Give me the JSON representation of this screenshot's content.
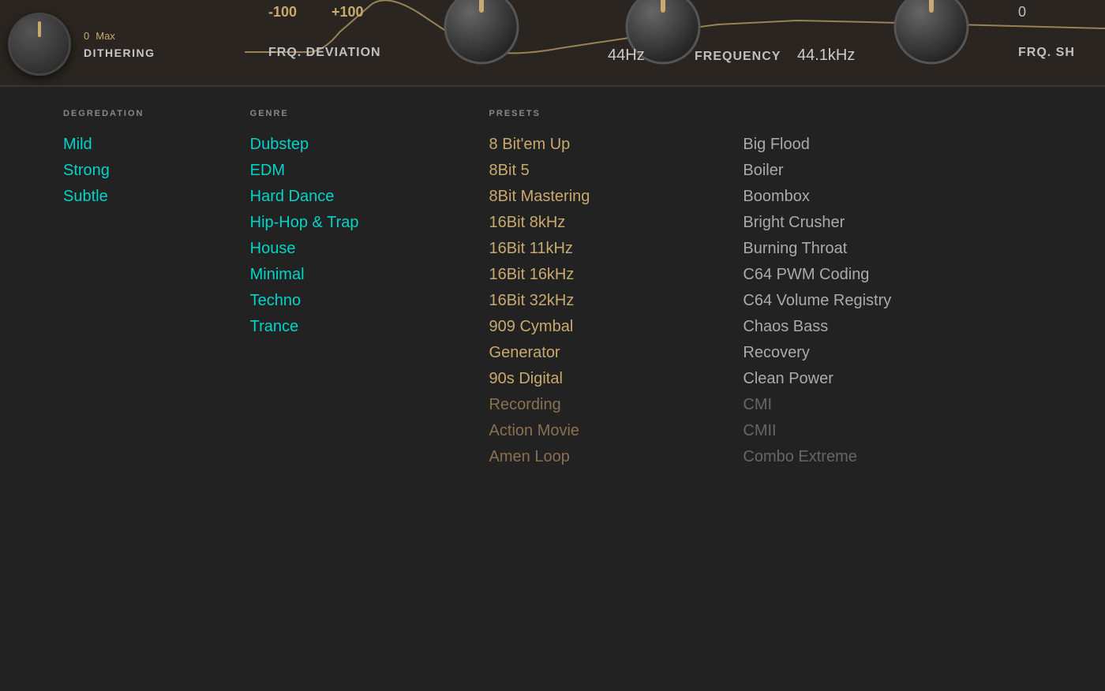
{
  "header": {
    "dithering": {
      "label": "DITHERING",
      "range_min": "0",
      "range_max": "Max"
    },
    "frq_deviation": {
      "label": "FRQ. DEVIATION",
      "range_min": "-100",
      "range_max": "+100"
    },
    "frequency": {
      "label": "FREQUENCY",
      "value1": "44Hz",
      "value2": "44.1kHz"
    },
    "frq_shape": {
      "label": "FRQ. SH"
    }
  },
  "sections": {
    "degradation_label": "DEGREDATION",
    "genre_label": "GENRE",
    "presets_label": "PRESETS"
  },
  "degradation_items": [
    {
      "id": "mild",
      "label": "Mild"
    },
    {
      "id": "strong",
      "label": "Strong"
    },
    {
      "id": "subtle",
      "label": "Subtle"
    }
  ],
  "genre_items": [
    {
      "id": "dubstep",
      "label": "Dubstep"
    },
    {
      "id": "edm",
      "label": "EDM"
    },
    {
      "id": "hard-dance",
      "label": "Hard Dance"
    },
    {
      "id": "hip-hop-trap",
      "label": "Hip-Hop & Trap"
    },
    {
      "id": "house",
      "label": "House"
    },
    {
      "id": "minimal",
      "label": "Minimal"
    },
    {
      "id": "techno",
      "label": "Techno"
    },
    {
      "id": "trance",
      "label": "Trance"
    }
  ],
  "presets_col1": [
    {
      "id": "8bitem-up",
      "label": "8 Bit'em Up",
      "dim": false
    },
    {
      "id": "8bit-5",
      "label": "8Bit 5",
      "dim": false
    },
    {
      "id": "8bit-mastering",
      "label": "8Bit Mastering",
      "dim": false
    },
    {
      "id": "16bit-8khz",
      "label": "16Bit 8kHz",
      "dim": false
    },
    {
      "id": "16bit-11khz",
      "label": "16Bit 11kHz",
      "dim": false
    },
    {
      "id": "16bit-16khz",
      "label": "16Bit 16kHz",
      "dim": false
    },
    {
      "id": "16bit-32khz",
      "label": "16Bit 32kHz",
      "dim": false
    },
    {
      "id": "909-cymbal",
      "label": "909 Cymbal",
      "dim": false
    },
    {
      "id": "generator",
      "label": "Generator",
      "dim": false
    },
    {
      "id": "90s-digital",
      "label": "90s Digital",
      "dim": false
    },
    {
      "id": "recording",
      "label": "Recording",
      "dim": true
    },
    {
      "id": "action-movie",
      "label": "Action Movie",
      "dim": true
    },
    {
      "id": "amen-loop",
      "label": "Amen Loop",
      "dim": true
    }
  ],
  "presets_col2": [
    {
      "id": "big-flood",
      "label": "Big Flood",
      "dim": false
    },
    {
      "id": "boiler",
      "label": "Boiler",
      "dim": false
    },
    {
      "id": "boombox",
      "label": "Boombox",
      "dim": false
    },
    {
      "id": "bright-crusher",
      "label": "Bright Crusher",
      "dim": false
    },
    {
      "id": "burning-throat",
      "label": "Burning Throat",
      "dim": false
    },
    {
      "id": "c64-pwm-coding",
      "label": "C64 PWM Coding",
      "dim": false
    },
    {
      "id": "c64-volume-registry",
      "label": "C64 Volume Registry",
      "dim": false
    },
    {
      "id": "chaos-bass",
      "label": "Chaos Bass",
      "dim": false
    },
    {
      "id": "recovery",
      "label": "Recovery",
      "dim": false
    },
    {
      "id": "clean-power",
      "label": "Clean Power",
      "dim": false
    },
    {
      "id": "cmi",
      "label": "CMI",
      "dim": true
    },
    {
      "id": "cmii",
      "label": "CMII",
      "dim": true
    },
    {
      "id": "combo-extreme",
      "label": "Combo Extreme",
      "dim": true
    }
  ],
  "colors": {
    "cyan": "#00d4c8",
    "amber": "#c8a96e",
    "amber_dim": "#8a7050",
    "gray": "#aaaaaa",
    "gray_dim": "#666666",
    "bg": "#222222",
    "header_bg": "#2a2520"
  }
}
